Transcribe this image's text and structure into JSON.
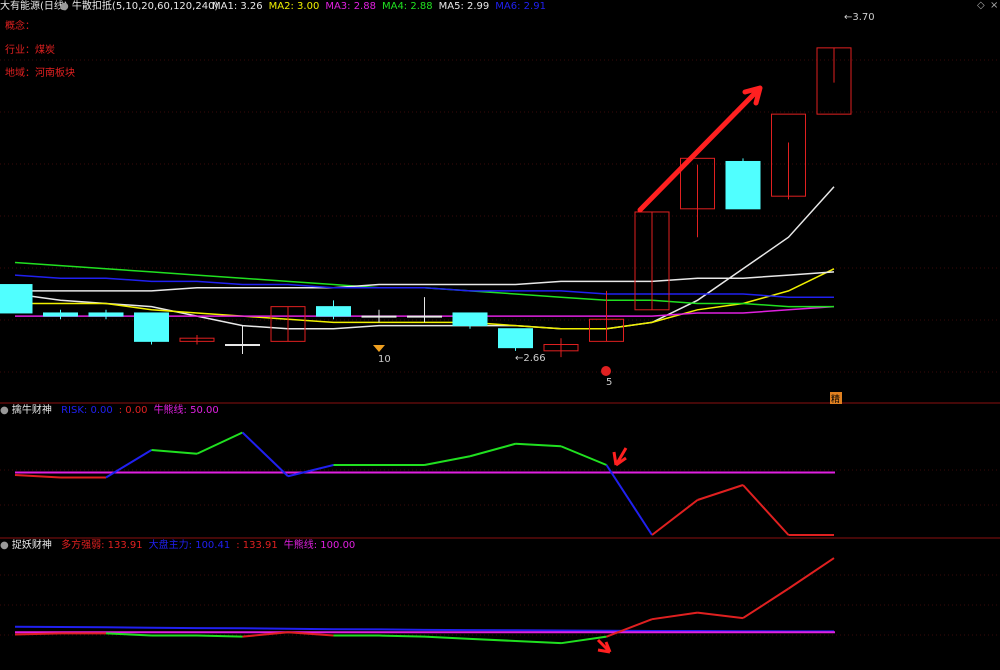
{
  "header": {
    "stock_name": "大有能源(日线)",
    "indicator_name": "牛散扣抵(5,10,20,60,120,240)",
    "ma_items": [
      {
        "label": "MA1: 3.26",
        "color": "#e8e8e8"
      },
      {
        "label": "MA2: 3.00",
        "color": "#f0f000"
      },
      {
        "label": "MA3: 2.88",
        "color": "#e020e0"
      },
      {
        "label": "MA4: 2.88",
        "color": "#20e020"
      },
      {
        "label": "MA5: 2.99",
        "color": "#e8e8e8"
      },
      {
        "label": "MA6: 2.91",
        "color": "#2020f0"
      }
    ],
    "window_controls": {
      "diamond": "◇",
      "close": "×"
    }
  },
  "side_info": {
    "concept": "概念：",
    "industry": "行业：煤炭",
    "region": "地域：河南板块"
  },
  "panel2_header": {
    "title": "擒牛财神",
    "items": [
      {
        "label": "RISK: 0.00",
        "color": "#2020f0"
      },
      {
        "label": ": 0.00",
        "color": "#e02020"
      },
      {
        "label": "牛熊线: 50.00",
        "color": "#e020e0"
      }
    ]
  },
  "panel3_header": {
    "title": "捉妖财神",
    "items": [
      {
        "label": "多方强弱: 133.91",
        "color": "#e02020"
      },
      {
        "label": "大盘主力: 100.41",
        "color": "#2020f0"
      },
      {
        "label": ": 133.91",
        "color": "#e02020"
      },
      {
        "label": "牛熊线: 100.00",
        "color": "#e020e0"
      }
    ]
  },
  "chart_data": {
    "type": "candlestick",
    "candles": [
      {
        "o": 2.95,
        "h": 2.95,
        "l": 2.86,
        "c": 2.86
      },
      {
        "o": 2.86,
        "h": 2.87,
        "l": 2.84,
        "c": 2.85
      },
      {
        "o": 2.86,
        "h": 2.87,
        "l": 2.84,
        "c": 2.85
      },
      {
        "o": 2.86,
        "h": 2.86,
        "l": 2.76,
        "c": 2.77
      },
      {
        "o": 2.77,
        "h": 2.79,
        "l": 2.76,
        "c": 2.78
      },
      {
        "o": 2.76,
        "h": 2.82,
        "l": 2.73,
        "c": 2.76
      },
      {
        "o": 2.77,
        "h": 2.88,
        "l": 2.77,
        "c": 2.88
      },
      {
        "o": 2.88,
        "h": 2.9,
        "l": 2.84,
        "c": 2.85
      },
      {
        "o": 2.85,
        "h": 2.87,
        "l": 2.83,
        "c": 2.85
      },
      {
        "o": 2.85,
        "h": 2.91,
        "l": 2.83,
        "c": 2.85
      },
      {
        "o": 2.86,
        "h": 2.86,
        "l": 2.81,
        "c": 2.82
      },
      {
        "o": 2.81,
        "h": 2.81,
        "l": 2.74,
        "c": 2.75
      },
      {
        "o": 2.74,
        "h": 2.78,
        "l": 2.72,
        "c": 2.76
      },
      {
        "o": 2.77,
        "h": 2.93,
        "l": 2.77,
        "c": 2.84
      },
      {
        "o": 2.87,
        "h": 3.18,
        "l": 2.87,
        "c": 3.18
      },
      {
        "o": 3.19,
        "h": 3.33,
        "l": 3.1,
        "c": 3.35
      },
      {
        "o": 3.34,
        "h": 3.35,
        "l": 3.19,
        "c": 3.19
      },
      {
        "o": 3.23,
        "h": 3.4,
        "l": 3.22,
        "c": 3.49
      },
      {
        "o": 3.49,
        "h": 3.7,
        "l": 3.59,
        "c": 3.7
      }
    ],
    "ma_lines": [
      {
        "name": "MA1",
        "color": "#e8e8e8",
        "values": [
          2.92,
          2.9,
          2.89,
          2.88,
          2.85,
          2.82,
          2.81,
          2.81,
          2.82,
          2.82,
          2.82,
          2.82,
          2.81,
          2.81,
          2.83,
          2.9,
          3.0,
          3.1,
          3.26
        ]
      },
      {
        "name": "MA2",
        "color": "#f0f000",
        "values": [
          2.89,
          2.89,
          2.89,
          2.87,
          2.86,
          2.85,
          2.84,
          2.83,
          2.83,
          2.83,
          2.83,
          2.82,
          2.81,
          2.81,
          2.83,
          2.87,
          2.89,
          2.93,
          3.0
        ]
      },
      {
        "name": "MA3",
        "color": "#e020e0",
        "values": [
          2.85,
          2.85,
          2.85,
          2.85,
          2.85,
          2.85,
          2.85,
          2.85,
          2.85,
          2.85,
          2.85,
          2.85,
          2.85,
          2.85,
          2.85,
          2.86,
          2.86,
          2.87,
          2.88
        ]
      },
      {
        "name": "MA4",
        "color": "#20e020",
        "values": [
          3.02,
          3.01,
          3.0,
          2.99,
          2.98,
          2.97,
          2.96,
          2.95,
          2.94,
          2.94,
          2.93,
          2.92,
          2.91,
          2.9,
          2.9,
          2.89,
          2.89,
          2.88,
          2.88
        ]
      },
      {
        "name": "MA5",
        "color": "#e8e8e8",
        "values": [
          2.93,
          2.93,
          2.93,
          2.93,
          2.94,
          2.94,
          2.94,
          2.94,
          2.95,
          2.95,
          2.95,
          2.95,
          2.96,
          2.96,
          2.96,
          2.97,
          2.97,
          2.98,
          2.99
        ]
      },
      {
        "name": "MA6",
        "color": "#2020f0",
        "values": [
          2.98,
          2.97,
          2.97,
          2.96,
          2.96,
          2.95,
          2.95,
          2.94,
          2.94,
          2.94,
          2.93,
          2.93,
          2.93,
          2.92,
          2.92,
          2.92,
          2.92,
          2.91,
          2.91
        ]
      }
    ],
    "ylim": [
      2.6,
      3.82
    ],
    "annotations": {
      "high_label": "3.70",
      "low_label": "2.66",
      "marker_a": "10",
      "marker_b": "5",
      "corner_tag": "精"
    },
    "osc1": {
      "ylim": [
        0,
        100
      ],
      "values": [
        48,
        46,
        46,
        68,
        65,
        82,
        47,
        56,
        56,
        56,
        63,
        73,
        71,
        56,
        0,
        28,
        40,
        0,
        0
      ],
      "colors": [
        "#e02020",
        "#e02020",
        "#2020f0",
        "#20e020",
        "#20e020",
        "#2020f0",
        "#2020f0",
        "#20e020",
        "#20e020",
        "#20e020",
        "#20e020",
        "#20e020",
        "#20e020",
        "#2020f0",
        "#e02020",
        "#e02020",
        "#e02020",
        "#e02020"
      ],
      "bull_bear": 50
    },
    "osc2": {
      "ylim": [
        85,
        140
      ],
      "strength": [
        99,
        99.5,
        99.5,
        98.5,
        98.5,
        98,
        100,
        98.5,
        98.5,
        98,
        97,
        96,
        95,
        98,
        106,
        109,
        106.5,
        120,
        134
      ],
      "strength_colors": [
        "#e02020",
        "#e02020",
        "#20e020",
        "#20e020",
        "#20e020",
        "#e02020",
        "#e02020",
        "#20e020",
        "#20e020",
        "#20e020",
        "#20e020",
        "#20e020",
        "#20e020",
        "#e02020",
        "#e02020",
        "#e02020",
        "#e02020",
        "#e02020"
      ],
      "market": [
        102.5,
        102.4,
        102.3,
        102.1,
        101.9,
        101.8,
        101.6,
        101.4,
        101.3,
        101.1,
        101.0,
        100.9,
        100.8,
        100.7,
        100.6,
        100.6,
        100.5,
        100.4,
        100.41
      ],
      "bull_bear": 100
    }
  }
}
